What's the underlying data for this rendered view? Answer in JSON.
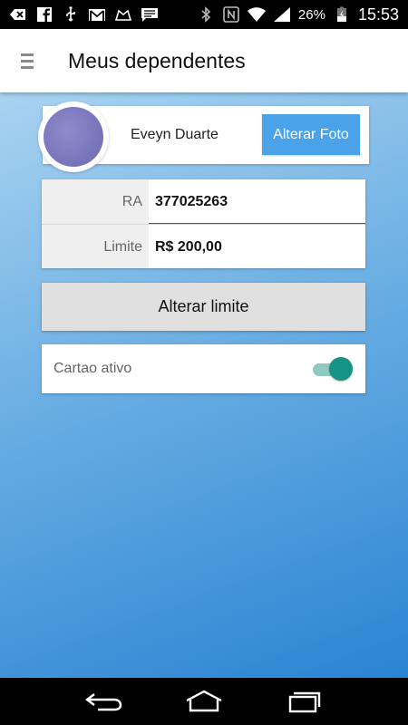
{
  "statusbar": {
    "battery_percent": "26%",
    "time": "15:53",
    "icons_left": [
      "back-arrow-icon",
      "facebook-icon",
      "usb-icon",
      "gmail-icon",
      "cloud-icon",
      "message-icon"
    ],
    "icons_right": [
      "bluetooth-icon",
      "nfc-icon",
      "wifi-icon",
      "signal-icon",
      "battery-icon"
    ]
  },
  "appbar": {
    "title": "Meus dependentes",
    "menu_icon": "hamburger-menu-icon"
  },
  "profile": {
    "name": "Eveyn Duarte",
    "change_photo_label": "Alterar Foto"
  },
  "info": {
    "ra_label": "RA",
    "ra_value": "377025263",
    "limit_label": "Limite",
    "limit_value": "R$ 200,00"
  },
  "actions": {
    "change_limit_label": "Alterar limite"
  },
  "card_toggle": {
    "label": "Cartao ativo",
    "checked": true
  },
  "colors": {
    "primary_button": "#4aa3e8",
    "toggle_accent": "#159384",
    "background_top": "#a9d3f1",
    "background_bottom": "#2a84d2"
  },
  "navbar": {
    "icons": [
      "back-icon",
      "home-icon",
      "recent-apps-icon"
    ]
  }
}
